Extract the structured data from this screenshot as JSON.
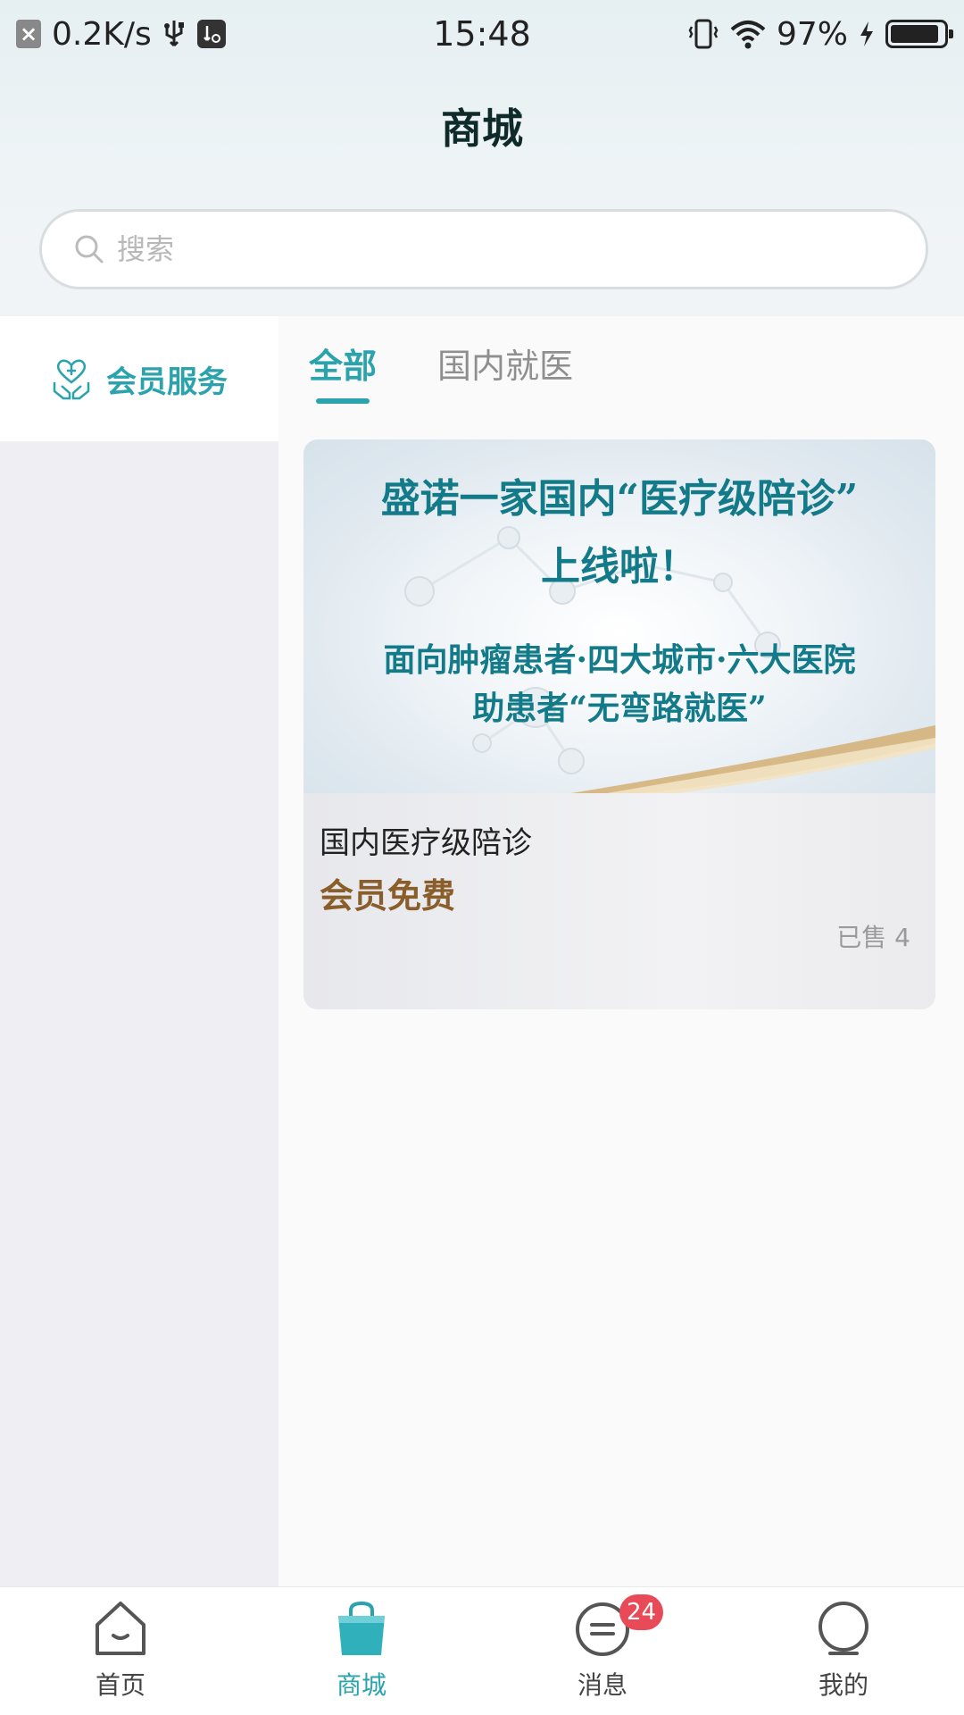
{
  "status_bar": {
    "net_speed": "0.2K/s",
    "time": "15:48",
    "battery_percent": "97%",
    "battery_level": 0.97,
    "icons": [
      "close-box-icon",
      "usb-icon",
      "usb-debug-icon",
      "vibrate-icon",
      "wifi-icon",
      "charging-icon",
      "battery-icon"
    ]
  },
  "header": {
    "title": "商城"
  },
  "search": {
    "placeholder": "搜索",
    "value": ""
  },
  "sidebar": {
    "items": [
      {
        "label": "会员服务",
        "icon": "heart-hands-icon",
        "selected": true
      }
    ]
  },
  "tabs": [
    {
      "label": "全部",
      "active": true
    },
    {
      "label": "国内就医",
      "active": false
    }
  ],
  "products": [
    {
      "banner": {
        "line1": "盛诺一家国内“医疗级陪诊”",
        "line2": "上线啦！",
        "line3": "面向肿瘤患者·四大城市·六大医院",
        "line4": "助患者“无弯路就医”"
      },
      "title": "国内医疗级陪诊",
      "price": "会员免费",
      "sold": "已售 4"
    }
  ],
  "bottom_nav": {
    "items": [
      {
        "label": "首页",
        "icon": "home-icon",
        "active": false
      },
      {
        "label": "商城",
        "icon": "shopping-bag-icon",
        "active": true
      },
      {
        "label": "消息",
        "icon": "message-icon",
        "active": false,
        "badge": "24"
      },
      {
        "label": "我的",
        "icon": "profile-icon",
        "active": false
      }
    ]
  },
  "colors": {
    "accent": "#2aa3ad",
    "price": "#8a5e2a",
    "badge": "#e84a57",
    "banner_text": "#127a88"
  }
}
